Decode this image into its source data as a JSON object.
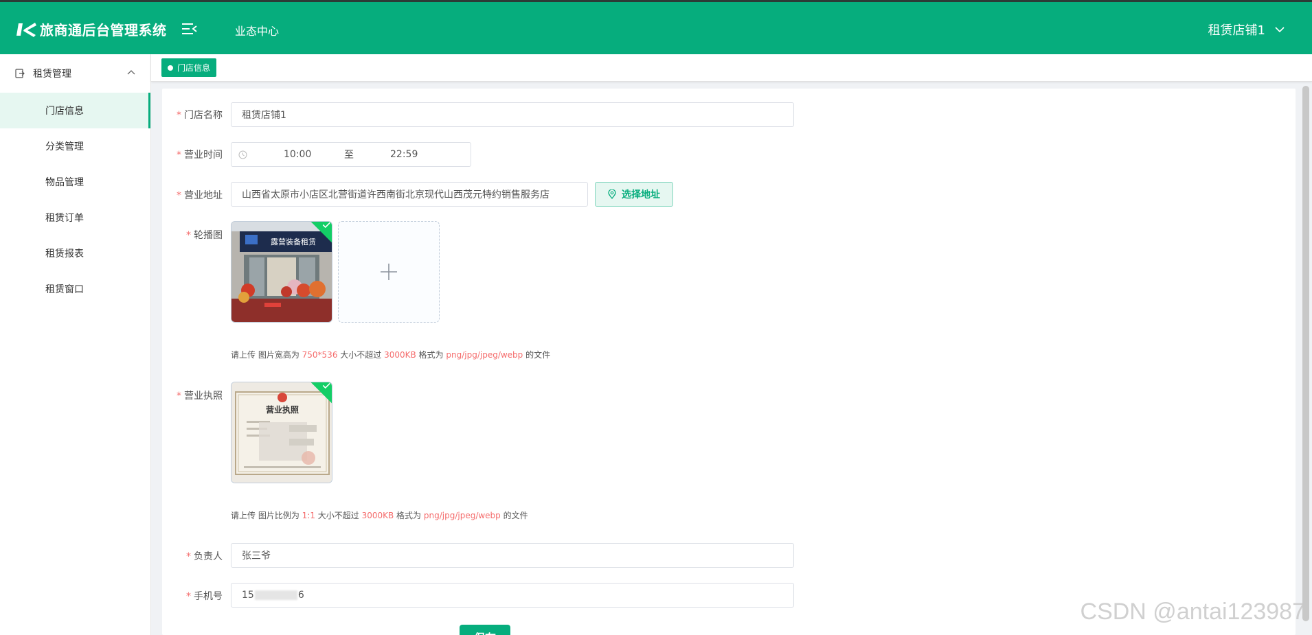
{
  "header": {
    "app_title": "旅商通后台管理系统",
    "nav_center": "业态中心",
    "user_name": "租赁店铺1"
  },
  "sidebar": {
    "group_label": "租赁管理",
    "items": [
      {
        "label": "门店信息",
        "active": true
      },
      {
        "label": "分类管理"
      },
      {
        "label": "物品管理"
      },
      {
        "label": "租赁订单"
      },
      {
        "label": "租赁报表"
      },
      {
        "label": "租赁窗口"
      }
    ]
  },
  "tags": {
    "active_tag": "门店信息"
  },
  "form": {
    "store_name": {
      "label": "门店名称",
      "value": "租赁店铺1"
    },
    "business_hours": {
      "label": "营业时间",
      "start": "10:00",
      "separator": "至",
      "end": "22:59"
    },
    "address": {
      "label": "营业地址",
      "value": "山西省太原市小店区北营街道许西南街北京现代山西茂元特约销售服务店",
      "button": "选择地址"
    },
    "carousel": {
      "label": "轮播图",
      "storefront_sign": "露营装备租赁",
      "hint": {
        "p1": "请上传 图片宽高为 ",
        "size": "750*536",
        "p2": " 大小不超过 ",
        "max": "3000KB",
        "p3": " 格式为 ",
        "formats": "png/jpg/jpeg/webp",
        "p4": " 的文件"
      }
    },
    "license": {
      "label": "营业执照",
      "cert_title": "营业执照",
      "hint": {
        "p1": "请上传 图片比例为 ",
        "ratio": "1:1",
        "p2": " 大小不超过 ",
        "max": "3000KB",
        "p3": " 格式为 ",
        "formats": "png/jpg/jpeg/webp",
        "p4": " 的文件"
      }
    },
    "manager": {
      "label": "负责人",
      "value": "张三爷"
    },
    "phone": {
      "label": "手机号",
      "prefix": "15",
      "suffix": "6"
    },
    "save_label": "保存"
  },
  "watermark": "CSDN @antai123987",
  "colors": {
    "brand": "#06ad7d",
    "required": "#f56c6c",
    "success": "#13ce66"
  }
}
